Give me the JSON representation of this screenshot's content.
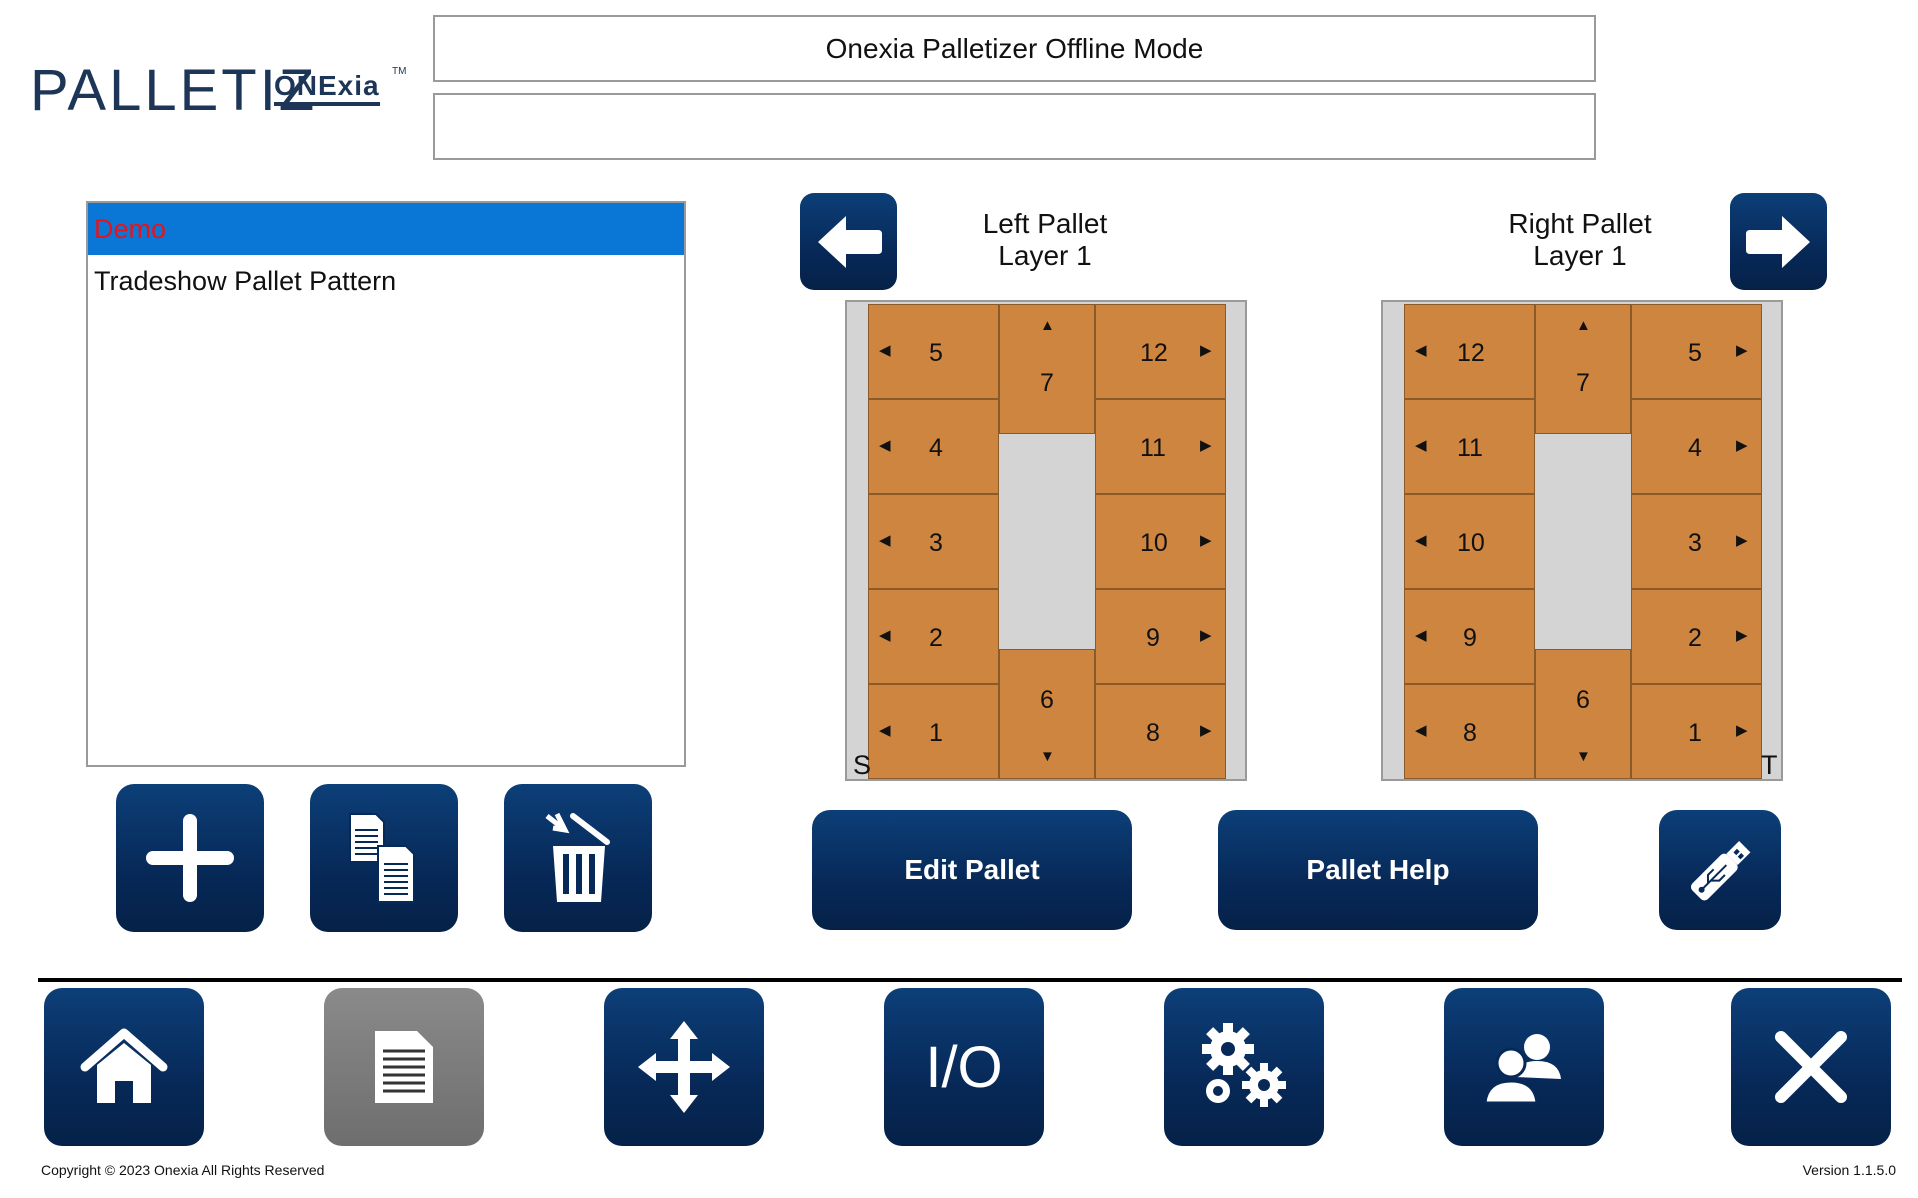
{
  "header": {
    "logo_text": "PALLETIZ",
    "logo_sub": "ONExia",
    "logo_tm": "TM",
    "title": "Onexia Palletizer Offline Mode",
    "message": ""
  },
  "recipes": {
    "items": [
      {
        "label": "Demo",
        "selected": true
      },
      {
        "label": "Tradeshow Pallet Pattern",
        "selected": false
      }
    ]
  },
  "recipe_actions": {
    "add": "add-icon",
    "copy": "copy-icon",
    "delete": "trash-icon"
  },
  "left_pallet": {
    "title": "Left Pallet",
    "layer": "Layer 1",
    "corner_label": "S",
    "boxes": {
      "b5": "5",
      "b4": "4",
      "b3": "3",
      "b2": "2",
      "b1": "1",
      "b7": "7",
      "b6": "6",
      "b12": "12",
      "b11": "11",
      "b10": "10",
      "b9": "9",
      "b8": "8"
    }
  },
  "right_pallet": {
    "title": "Right Pallet",
    "layer": "Layer 1",
    "corner_label": "T",
    "boxes": {
      "b12": "12",
      "b11": "11",
      "b10": "10",
      "b9": "9",
      "b8": "8",
      "b7": "7",
      "b6": "6",
      "b5": "5",
      "b4": "4",
      "b3": "3",
      "b2": "2",
      "b1": "1"
    }
  },
  "pallet_actions": {
    "edit": "Edit Pallet",
    "help": "Pallet Help"
  },
  "nav": {
    "home": "home-icon",
    "recipe": "document-icon",
    "jog": "move-icon",
    "io": "I/O",
    "settings": "gears-icon",
    "users": "users-icon",
    "exit": "close-icon"
  },
  "footer": {
    "copyright": "Copyright © 2023 Onexia All Rights Reserved",
    "version": "Version 1.1.5.0"
  },
  "colors": {
    "button_navy": "#072958",
    "button_gray": "#767676",
    "box_orange": "#ce8540",
    "selection_blue": "#0a77d6",
    "selection_text": "#e5141b"
  }
}
